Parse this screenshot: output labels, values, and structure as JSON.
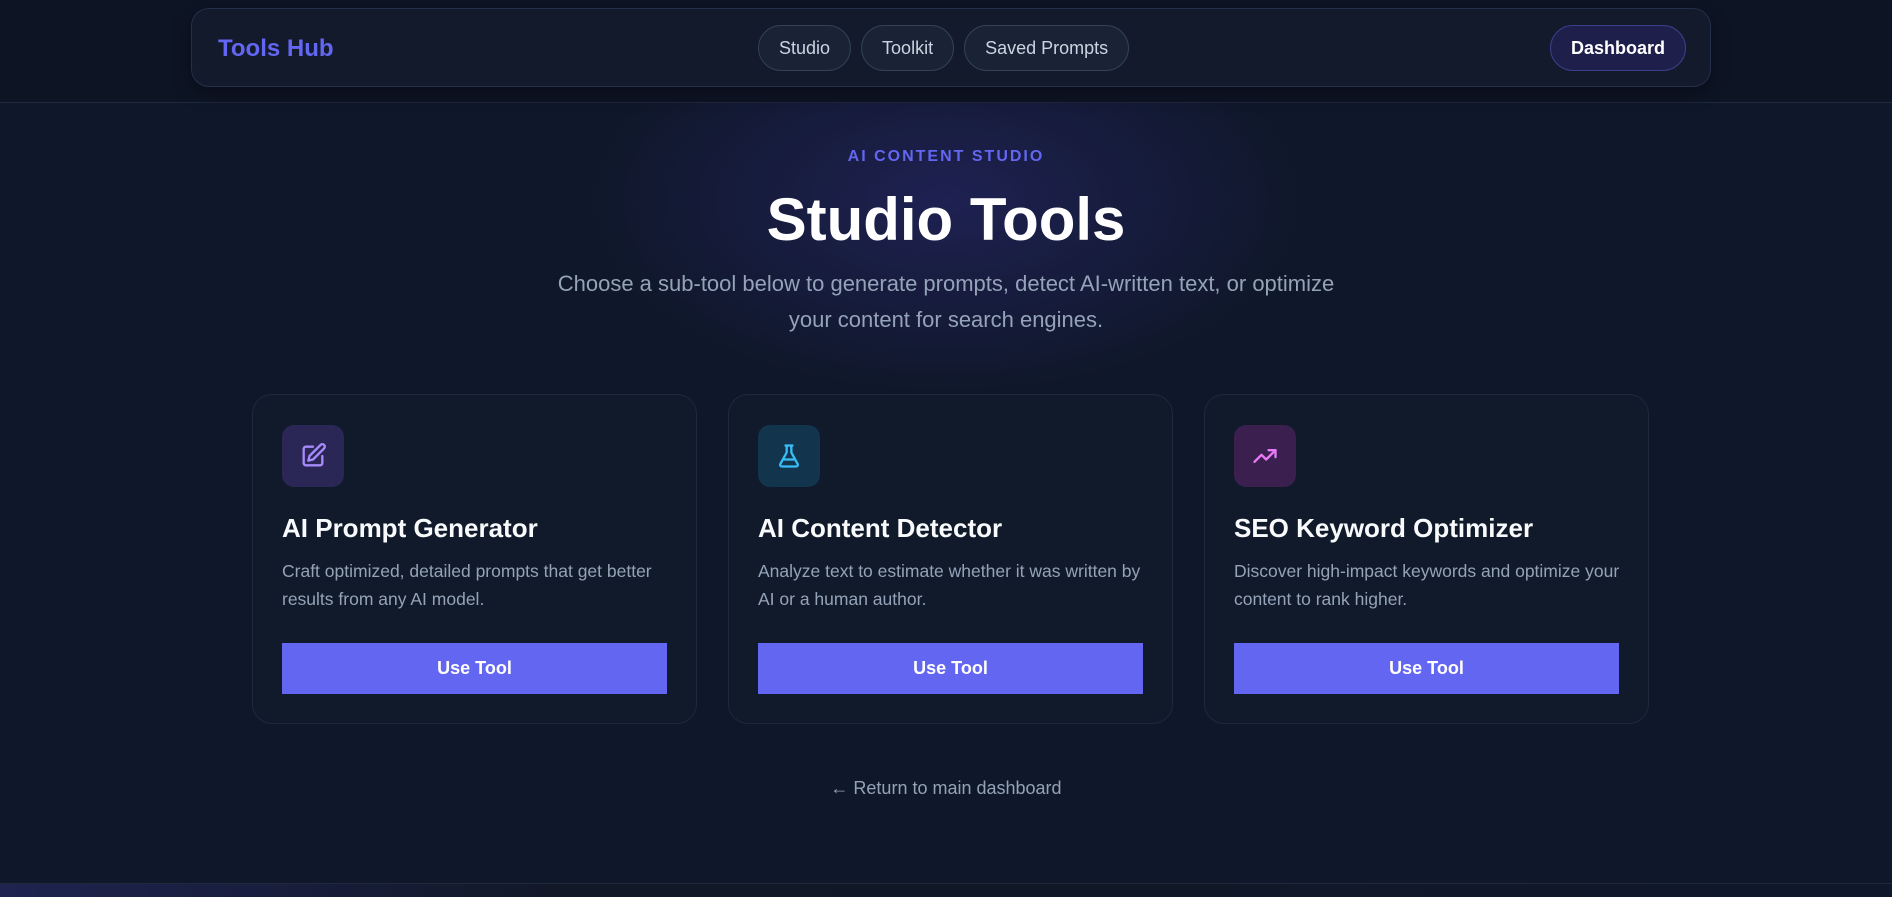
{
  "header": {
    "brand": "Tools Hub",
    "nav": [
      "Studio",
      "Toolkit",
      "Saved Prompts"
    ],
    "dashboard_label": "Dashboard"
  },
  "hero": {
    "eyebrow": "AI CONTENT STUDIO",
    "title": "Studio Tools",
    "subtitle": "Choose a sub-tool below to generate prompts, detect AI-written text, or optimize your content for search engines."
  },
  "cards": [
    {
      "icon": "pencil-edit-icon",
      "title": "AI Prompt Generator",
      "description": "Craft optimized, detailed prompts that get better results from any AI model.",
      "button": "Use Tool",
      "accent": "#a78bfa",
      "icon_bg": "#2a2756"
    },
    {
      "icon": "flask-icon",
      "title": "AI Content Detector",
      "description": "Analyze text to estimate whether it was written by AI or a human author.",
      "button": "Use Tool",
      "accent": "#38bdf8",
      "icon_bg": "#12344d"
    },
    {
      "icon": "trending-up-icon",
      "title": "SEO Keyword Optimizer",
      "description": "Discover high-impact keywords and optimize your content to rank higher.",
      "button": "Use Tool",
      "accent": "#e879f9",
      "icon_bg": "#3a1f4f"
    }
  ],
  "footer": {
    "return_link": "← Return to main dashboard"
  },
  "colors": {
    "background": "#0f172a",
    "primary": "#6366f1",
    "muted_text": "#94a3b8"
  }
}
